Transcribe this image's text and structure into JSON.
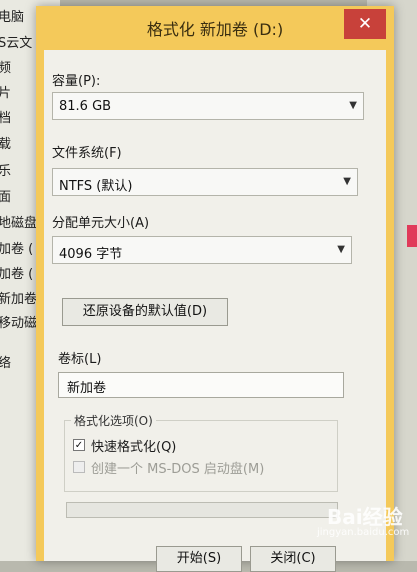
{
  "background": {
    "explorer_items": [
      "电脑",
      "S云文",
      "频",
      "片",
      "档",
      "载",
      "乐",
      "面",
      "地磁盘",
      "加卷 (",
      "加卷 (",
      "新加卷 (",
      "移动磁",
      "络"
    ]
  },
  "dialog": {
    "title": "格式化 新加卷 (D:)",
    "close_glyph": "✕",
    "capacity": {
      "label": "容量(P):",
      "value": "81.6 GB"
    },
    "filesystem": {
      "label": "文件系统(F)",
      "value": "NTFS (默认)"
    },
    "allocation": {
      "label": "分配单元大小(A)",
      "value": "4096 字节"
    },
    "restore_defaults_label": "还原设备的默认值(D)",
    "volume_label": {
      "label": "卷标(L)",
      "value": "新加卷"
    },
    "format_options": {
      "legend": "格式化选项(O)",
      "quick_format": {
        "label": "快速格式化(Q)",
        "checked": true,
        "check_glyph": "✓"
      },
      "msdos_boot": {
        "label": "创建一个 MS-DOS 启动盘(M)",
        "checked": false,
        "enabled": false
      }
    },
    "progress": 0,
    "buttons": {
      "start": "开始(S)",
      "close": "关闭(C)"
    },
    "arrow_glyph": "▼"
  },
  "watermark": {
    "brand": "Bai经验",
    "url": "jingyan.baidu.com"
  },
  "colors": {
    "titlebar": "#f4c95a",
    "close_button": "#c8413a",
    "client": "#f1f0ea"
  }
}
